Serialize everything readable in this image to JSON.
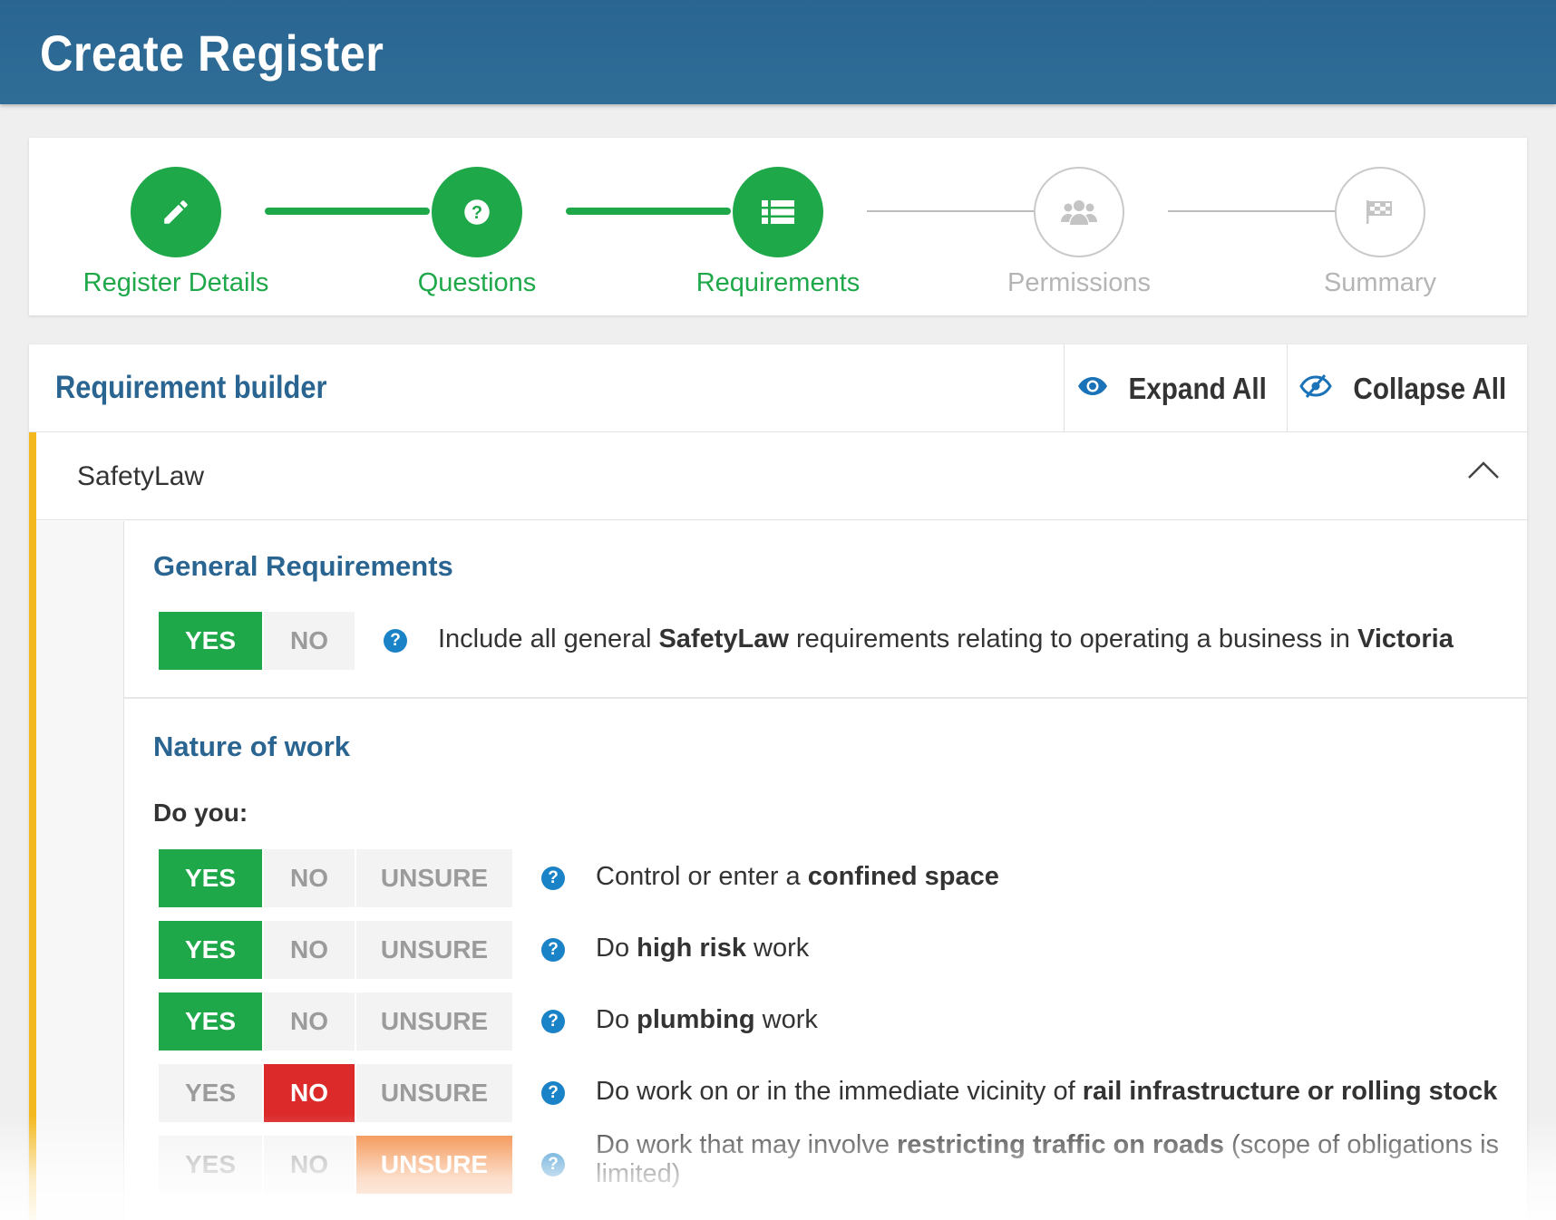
{
  "header": {
    "title": "Create Register"
  },
  "stepper": {
    "steps": [
      {
        "label": "Register Details",
        "icon": "pencil-icon",
        "state": "done"
      },
      {
        "label": "Questions",
        "icon": "question-circle-icon",
        "state": "done"
      },
      {
        "label": "Requirements",
        "icon": "list-icon",
        "state": "done"
      },
      {
        "label": "Permissions",
        "icon": "users-icon",
        "state": "todo"
      },
      {
        "label": "Summary",
        "icon": "flag-icon",
        "state": "todo"
      }
    ]
  },
  "builder": {
    "title": "Requirement builder",
    "expand_all": "Expand All",
    "collapse_all": "Collapse All",
    "group_name": "SafetyLaw"
  },
  "general": {
    "title": "General Requirements",
    "yes": "YES",
    "no": "NO",
    "selected": "YES",
    "text": {
      "t1": "Include all general ",
      "b1": "SafetyLaw",
      "t2": " requirements relating to operating a business in ",
      "b2": "Victoria"
    }
  },
  "nature": {
    "title": "Nature of work",
    "prompt": "Do you:",
    "options": {
      "yes": "YES",
      "no": "NO",
      "unsure": "UNSURE"
    },
    "questions": [
      {
        "selected": "YES",
        "t1": "Control or enter a ",
        "b1": "confined space",
        "t2": ""
      },
      {
        "selected": "YES",
        "t1": "Do ",
        "b1": "high risk",
        "t2": " work"
      },
      {
        "selected": "YES",
        "t1": "Do ",
        "b1": "plumbing",
        "t2": " work"
      },
      {
        "selected": "NO",
        "t1": "Do work on or in the immediate vicinity of ",
        "b1": "rail infrastructure or rolling stock",
        "t2": ""
      },
      {
        "selected": "UNSURE",
        "t1": "Do work that may involve ",
        "b1": "restricting traffic on roads",
        "t2": " (scope of obligations is",
        "t3": "limited)"
      }
    ]
  },
  "colors": {
    "green": "#1fa84a",
    "blue": "#2a6592",
    "red": "#dc2a2a",
    "orange": "#f27c2c",
    "yellow": "#f3b81d"
  }
}
